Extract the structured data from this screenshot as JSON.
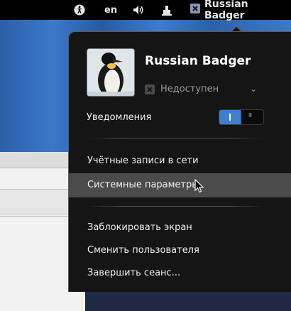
{
  "topbar": {
    "accessibility_icon": "accessibility-icon",
    "language": "en",
    "volume_icon": "volume-icon",
    "network_icon": "network-icon",
    "user_status_icon": "offline-status-icon",
    "user_name": "Russian Badger"
  },
  "menu": {
    "avatar_icon": "penguin-avatar",
    "user_name": "Russian Badger",
    "status": {
      "icon": "offline-status-icon",
      "label": "Недоступен",
      "chevron": "chevron-down-icon"
    },
    "notifications": {
      "label": "Уведомления",
      "enabled": true
    },
    "items": [
      {
        "label": "Учётные записи в сети"
      },
      {
        "label": "Системные параметры",
        "hovered": true
      },
      {
        "label": "Заблокировать экран"
      },
      {
        "label": "Сменить пользователя"
      },
      {
        "label": "Завершить сеанс..."
      }
    ]
  },
  "colors": {
    "accent": "#3f7fcf",
    "menu_bg": "#151515",
    "hover": "#4b4b4b",
    "topbar_bg": "#000000"
  }
}
